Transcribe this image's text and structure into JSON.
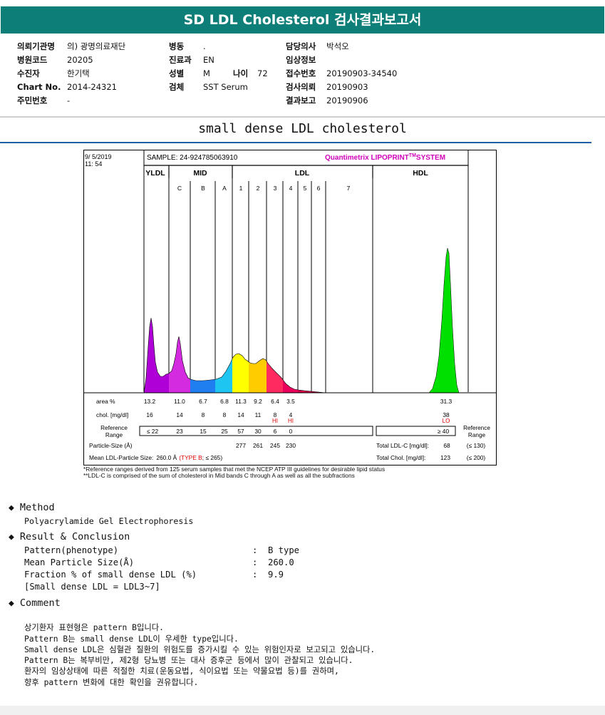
{
  "header": {
    "title": "SD LDL Cholesterol 검사결과보고서"
  },
  "info": {
    "col1": [
      {
        "label": "의뢰기관명",
        "value": "의) 광명의료재단"
      },
      {
        "label": "병원코드",
        "value": "20205"
      },
      {
        "label": "수진자",
        "value": "한기택"
      },
      {
        "label": "Chart No.",
        "value": "2014-24321"
      },
      {
        "label": "주민번호",
        "value": "-"
      }
    ],
    "col2": [
      {
        "label": "병동",
        "value": "."
      },
      {
        "label": "진료과",
        "value": "EN"
      },
      {
        "label": "성별",
        "value": "M"
      },
      {
        "label": "검체",
        "value": "SST Serum"
      }
    ],
    "age": {
      "label": "나이",
      "value": "72"
    },
    "col3": [
      {
        "label": "담당의사",
        "value": "박석오"
      },
      {
        "label": "임상정보",
        "value": ""
      },
      {
        "label": "접수번호",
        "value": "20190903-34540"
      },
      {
        "label": "검사의뢰",
        "value": "20190903"
      },
      {
        "label": "결과보고",
        "value": "20190906"
      }
    ]
  },
  "subtitle": "small dense LDL cholesterol",
  "chart_data": {
    "type": "area",
    "date": "9/ 5/2019",
    "time": "11: 54",
    "sample": "SAMPLE:  24-924785063910",
    "brand": "Quantimetrix LIPOPRINT",
    "brand_tm": "TM",
    "brand_end": "SYSTEM",
    "groups": [
      "YLDL",
      "MID",
      "LDL",
      "HDL"
    ],
    "bands": [
      "C",
      "B",
      "A",
      "1",
      "2",
      "3",
      "4",
      "5",
      "6",
      "7"
    ],
    "band_colors": {
      "VLDL": "#b000d8",
      "C": "#d42ae0",
      "B": "#1f7ff0",
      "A": "#1ec5f0",
      "1": "#ffff00",
      "2": "#ffcc00",
      "3": "#ff2a60",
      "4": "#e8005a",
      "5": "#d00048",
      "6": "#c00040",
      "HDL": "#00e000"
    },
    "rows": {
      "area_label": "area %",
      "area": [
        "13.2",
        "11.0",
        "6.7",
        "6.8",
        "11.3",
        "9.2",
        "6.4",
        "3.5",
        "31.3"
      ],
      "chol_label": "chol. [mg/dl]",
      "chol": [
        "16",
        "14",
        "8",
        "8",
        "14",
        "11",
        "8",
        "4",
        "38"
      ],
      "flags": [
        "HI",
        "HI",
        "LO"
      ],
      "ref_label_1": "Reference",
      "ref_label_2": "Range",
      "ref": [
        "≤ 22",
        "23",
        "15",
        "25",
        "57",
        "30",
        "6",
        "0",
        "≥ 40"
      ],
      "ref_right_1": "Reference",
      "ref_right_2": "Range",
      "particle_label": "Particle-Size (Å)",
      "particle": [
        "277",
        "261",
        "245",
        "230"
      ],
      "total_ldl_label": "Total LDL-C [mg/dl]:",
      "total_ldl": "68",
      "total_ldl_ref": "(≤ 130)",
      "mean_label": "Mean LDL-Particle Size:",
      "mean_value": "260.0 Å",
      "mean_type": "(TYPE B",
      "mean_ref": "; ≤ 265)",
      "total_chol_label": "Total Chol. [mg/dl]:",
      "total_chol": "123",
      "total_chol_ref": "(≤ 200)"
    }
  },
  "notes": [
    "*Reference ranges derived from 125 serum samples that met the NCEP ATP III guidelines for desirable lipid status",
    "**LDL-C is comprised of the sum of cholesterol in Mid bands C through A as well as all the subfractions"
  ],
  "method": {
    "heading": "Method",
    "text": "Polyacrylamide Gel Electrophoresis"
  },
  "result": {
    "heading": "Result & Conclusion",
    "items": [
      {
        "k": "Pattern(phenotype)",
        "v": "B type"
      },
      {
        "k": "Mean Particle Size(Å)",
        "v": "260.0"
      },
      {
        "k": "Fraction % of small dense LDL (%)",
        "v": "9.9"
      }
    ],
    "note": "[Small dense LDL = LDL3~7]"
  },
  "comment": {
    "heading": "Comment",
    "lines": [
      "상기환자 표현형은 pattern B입니다.",
      "Pattern B는 small dense LDL이 우세한 type입니다.",
      "Small dense LDL은 심혈관 질환의 위험도를 증가시킬 수 있는 위험인자로 보고되고 있습니다.",
      "Pattern B는 복부비만, 제2형 당뇨병 또는 대사 증후군 등에서 많이 관찰되고 있습니다.",
      "환자의 임상상태에 따른 적절한 치료(운동요법, 식이요법 또는 약물요법 등)를 권하며,",
      "향후 pattern 변화에 대한 확인을 권유합니다."
    ]
  }
}
